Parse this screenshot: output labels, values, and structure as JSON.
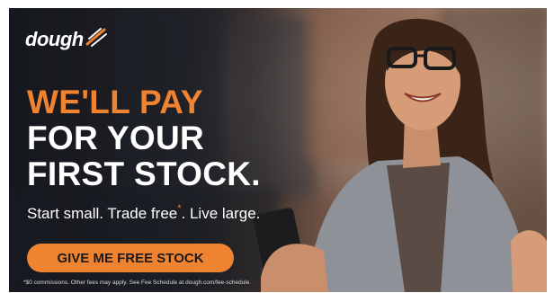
{
  "ad": {
    "brand": "dough",
    "headline_lines": [
      "WE'LL PAY",
      "FOR YOUR",
      "FIRST STOCK."
    ],
    "tagline": {
      "part1": "Start small. Trade free",
      "asterisk": "*",
      "part2": ". Live large."
    },
    "cta_label": "GIVE ME FREE STOCK",
    "disclaimer": "*$0 commissions. Other fees may apply. See Fee Schedule at dough.com/fee-schedule.",
    "colors": {
      "accent": "#f0832f",
      "text": "#ffffff"
    },
    "image_alt_icon": "woman-celebrating-with-phone"
  }
}
